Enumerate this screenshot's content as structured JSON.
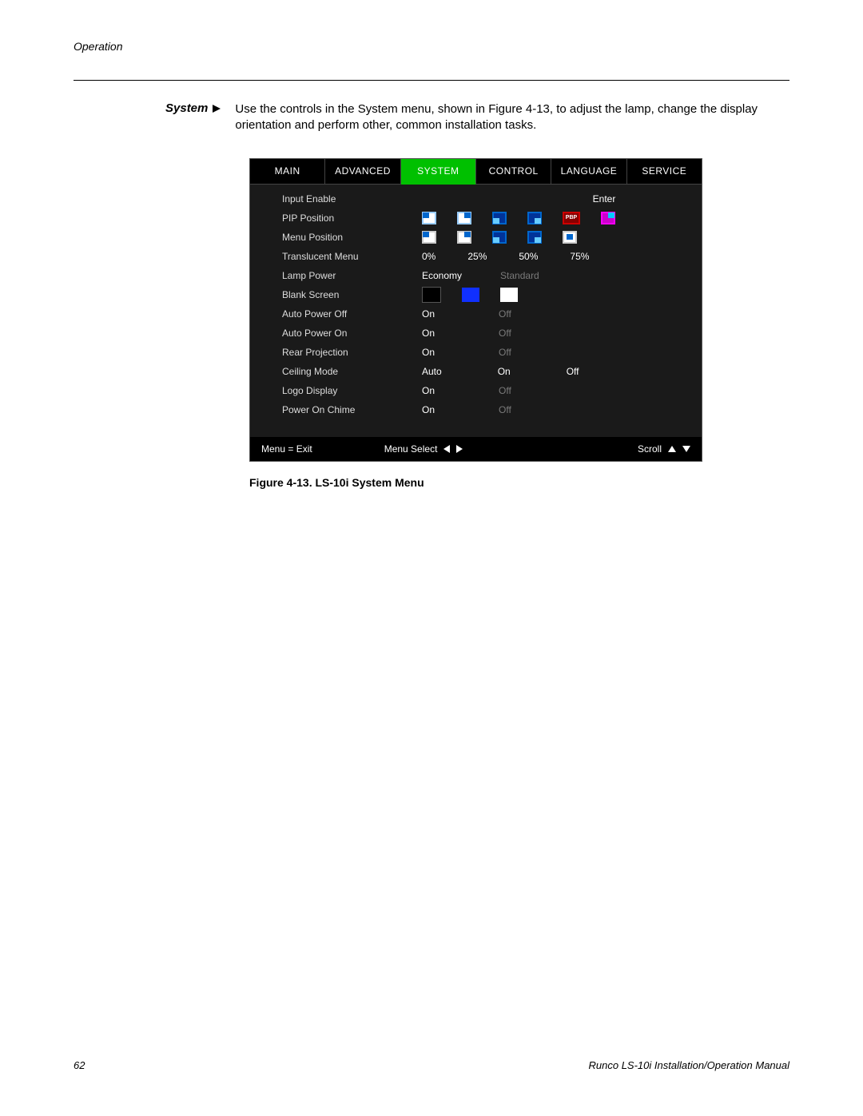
{
  "page": {
    "running_head": "Operation",
    "section_label": "System",
    "intro_text": "Use the controls in the System menu, shown in Figure 4-13, to adjust the lamp, change the display orientation and perform other, common installation tasks.",
    "caption": "Figure 4-13. LS-10i System Menu",
    "page_number": "62",
    "doc_title": "Runco LS-10i Installation/Operation Manual"
  },
  "menu": {
    "tabs": {
      "main": "MAIN",
      "advanced": "ADVANCED",
      "system": "SYSTEM",
      "control": "CONTROL",
      "language": "LANGUAGE",
      "service": "SERVICE"
    },
    "rows": {
      "input_enable": {
        "label": "Input Enable",
        "value": "Enter"
      },
      "pip_position": {
        "label": "PIP Position"
      },
      "menu_position": {
        "label": "Menu Position"
      },
      "translucent": {
        "label": "Translucent Menu",
        "o0": "0%",
        "o1": "25%",
        "o2": "50%",
        "o3": "75%"
      },
      "lamp_power": {
        "label": "Lamp Power",
        "o0": "Economy",
        "o1": "Standard"
      },
      "blank_screen": {
        "label": "Blank Screen"
      },
      "auto_power_off": {
        "label": "Auto Power Off",
        "o0": "On",
        "o1": "Off"
      },
      "auto_power_on": {
        "label": "Auto Power On",
        "o0": "On",
        "o1": "Off"
      },
      "rear_projection": {
        "label": "Rear Projection",
        "o0": "On",
        "o1": "Off"
      },
      "ceiling_mode": {
        "label": "Ceiling Mode",
        "o0": "Auto",
        "o1": "On",
        "o2": "Off"
      },
      "logo_display": {
        "label": "Logo Display",
        "o0": "On",
        "o1": "Off"
      },
      "power_on_chime": {
        "label": "Power On Chime",
        "o0": "On",
        "o1": "Off"
      }
    },
    "footer": {
      "exit": "Menu = Exit",
      "select": "Menu Select",
      "scroll": "Scroll"
    },
    "pip_icon_label": "PBP"
  }
}
